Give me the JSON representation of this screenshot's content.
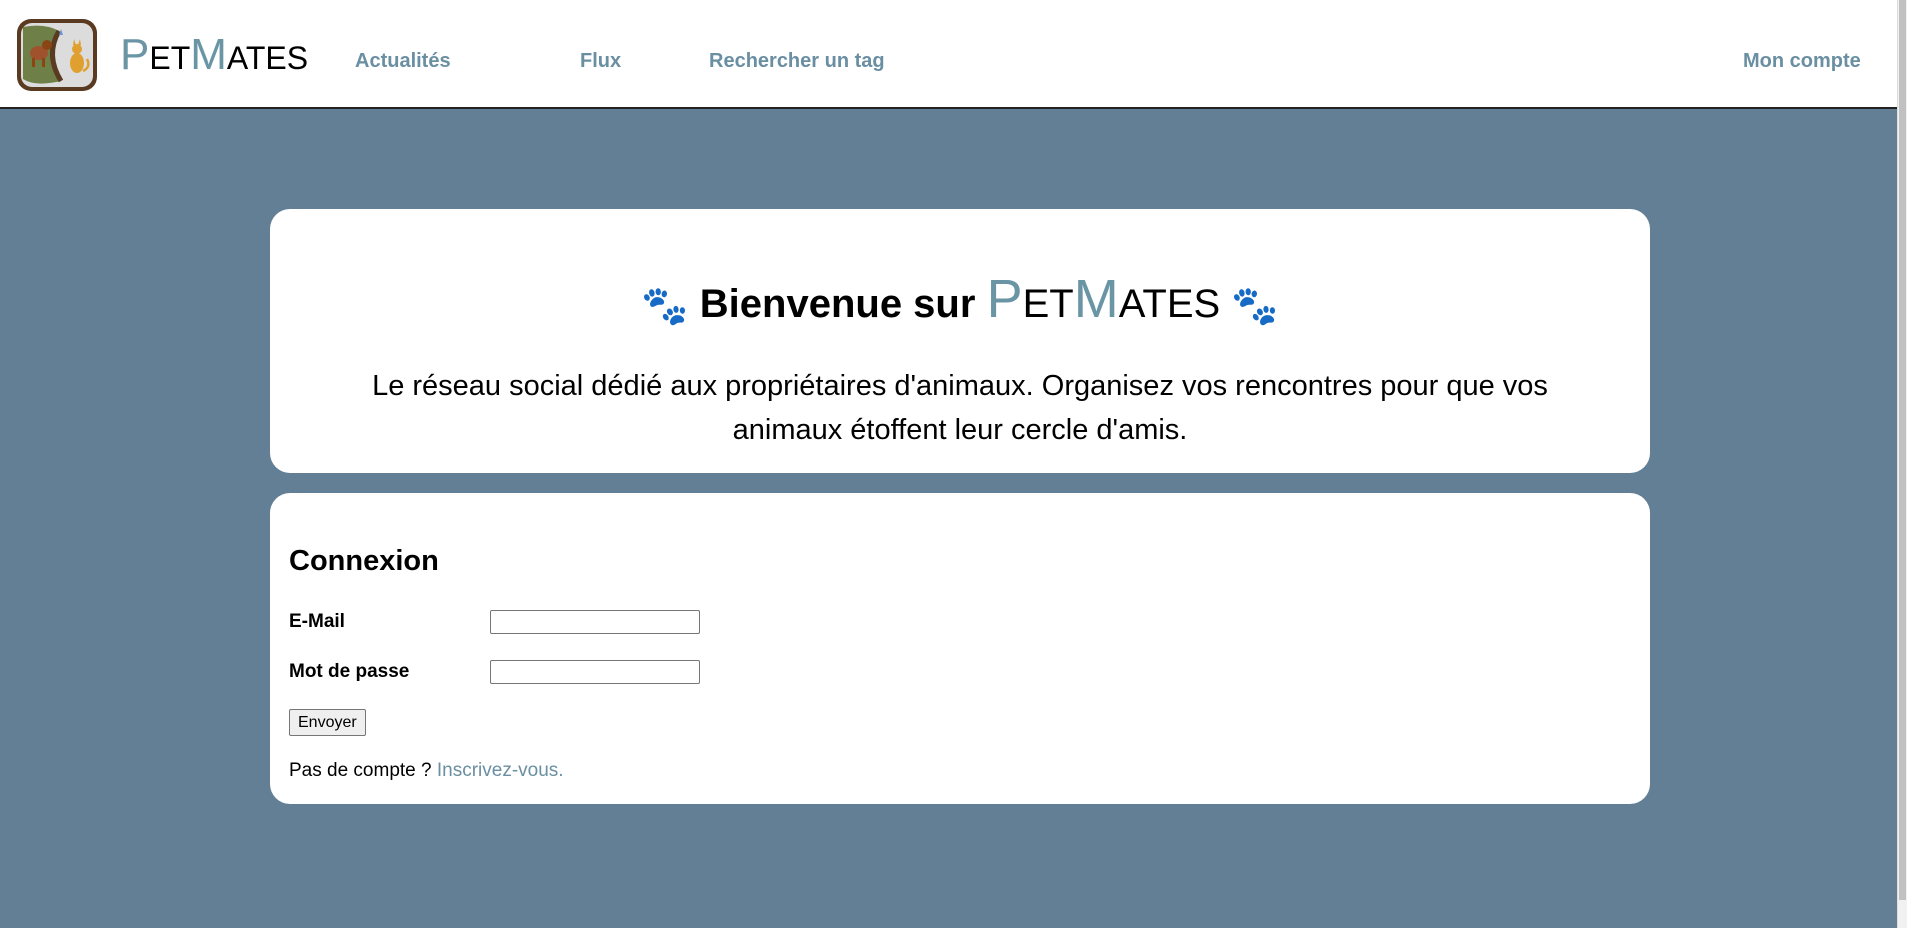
{
  "header": {
    "brand": {
      "p": "P",
      "et": "ET",
      "m": "M",
      "ates": "ATES"
    },
    "nav": {
      "news": "Actualités",
      "feed": "Flux",
      "search_tag": "Rechercher un tag",
      "account": "Mon compte"
    }
  },
  "welcome": {
    "title_prefix": "Bienvenue sur",
    "brand": {
      "p": "P",
      "et": "ET",
      "m": "M",
      "ates": "ATES"
    },
    "paw_icon": "🐾",
    "description": "Le réseau social dédié aux propriétaires d'animaux. Organisez vos rencontres pour que vos animaux étoffent leur cercle d'amis."
  },
  "login": {
    "title": "Connexion",
    "email_label": "E-Mail",
    "email_value": "",
    "password_label": "Mot de passe",
    "password_value": "",
    "submit_label": "Envoyer",
    "no_account_text": "Pas de compte ?",
    "signup_link": "Inscrivez-vous."
  },
  "colors": {
    "background": "#637f95",
    "accent": "#6a95a5",
    "nav_link": "#6a8fa2",
    "paw": "#5b5b9a"
  }
}
